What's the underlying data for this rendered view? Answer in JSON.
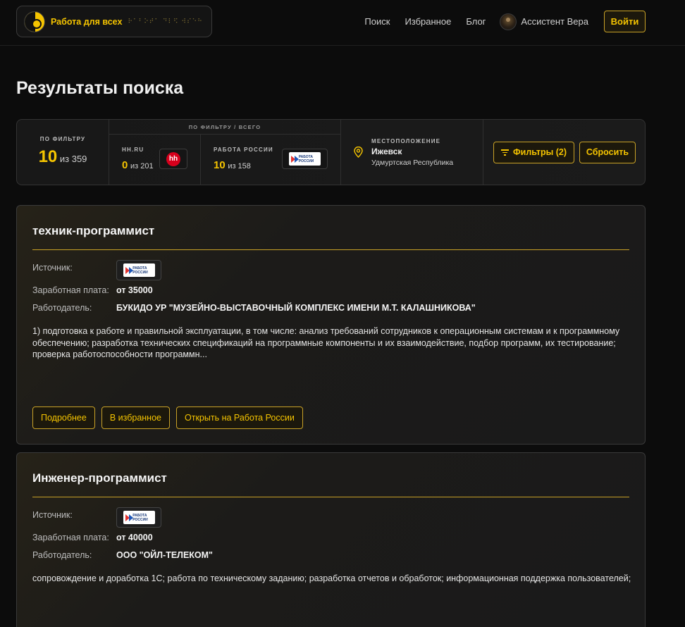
{
  "header": {
    "brand_name": "Работа для всех",
    "brand_braille": "⠗⠁⠃⠕⠞⠁ ⠙⠇⠫ ⠺⠎⠑⠓",
    "nav": [
      "Поиск",
      "Избранное",
      "Блог"
    ],
    "assistant_label": "Ассистент Вера",
    "login_label": "Войти"
  },
  "page_title": "Результаты поиска",
  "stats": {
    "filter_label": "по фильтру",
    "filter_count": "10",
    "filter_of": "из 359",
    "sources_label": "ПО ФИЛЬТРУ / ВСЕГО",
    "hh": {
      "label": "hh.ru",
      "count": "0",
      "of": "из 201",
      "logo_text": "hh"
    },
    "rr": {
      "label": "Работа России",
      "count": "10",
      "of": "из 158",
      "logo_text": "Работа России"
    },
    "location": {
      "label": "Местоположение",
      "city": "Ижевск",
      "region": "Удмуртская Республика"
    },
    "filters_label": "Фильтры (2)",
    "reset_label": "Сбросить"
  },
  "jobs": [
    {
      "title": "техник-программист",
      "source_label": "Источник:",
      "source_logo_text": "Работа России",
      "salary_label": "Заработная плата:",
      "salary": "от 35000",
      "employer_label": "Работодатель:",
      "employer": "БУКИДО УР \"МУЗЕЙНО-ВЫСТАВОЧНЫЙ КОМПЛЕКС ИМЕНИ М.Т. КАЛАШНИКОВА\"",
      "description": "1) подготовка к работе и правильной эксплуатации, в том числе: анализ требований сотрудников к операционным системам и к программному обеспечению; разработка технических спецификаций на программные компоненты и их взаимодействие, подбор программ, их тестирование; проверка работоспособности программн...",
      "buttons": [
        "Подробнее",
        "В избранное",
        "Открыть на Работа России"
      ]
    },
    {
      "title": "Инженер-программист",
      "source_label": "Источник:",
      "source_logo_text": "Работа России",
      "salary_label": "Заработная плата:",
      "salary": "от 40000",
      "employer_label": "Работодатель:",
      "employer": "ООО \"ОЙЛ-ТЕЛЕКОМ\"",
      "description": "сопровождение и доработка 1С; работа по техническому заданию; разработка отчетов и обработок; информационная поддержка пользователей;"
    }
  ],
  "colors": {
    "accent": "#f5c400",
    "background": "#0c0c0c",
    "card_border": "#3a3a3a"
  }
}
